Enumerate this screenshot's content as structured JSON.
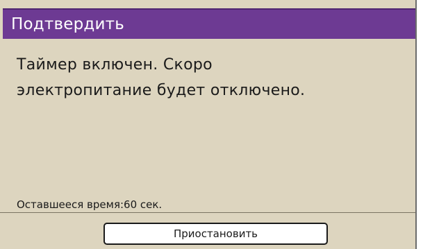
{
  "dialog": {
    "title": "Подтвердить",
    "message_line1": "Таймер включен. Скоро",
    "message_line2": "электропитание будет отключено.",
    "remaining_time": "Оставшееся время:60 сек.",
    "pause_label": "Приостановить"
  },
  "colors": {
    "titlebar": "#6d3a93",
    "background": "#ddd5bf",
    "button": "#ffffff"
  }
}
